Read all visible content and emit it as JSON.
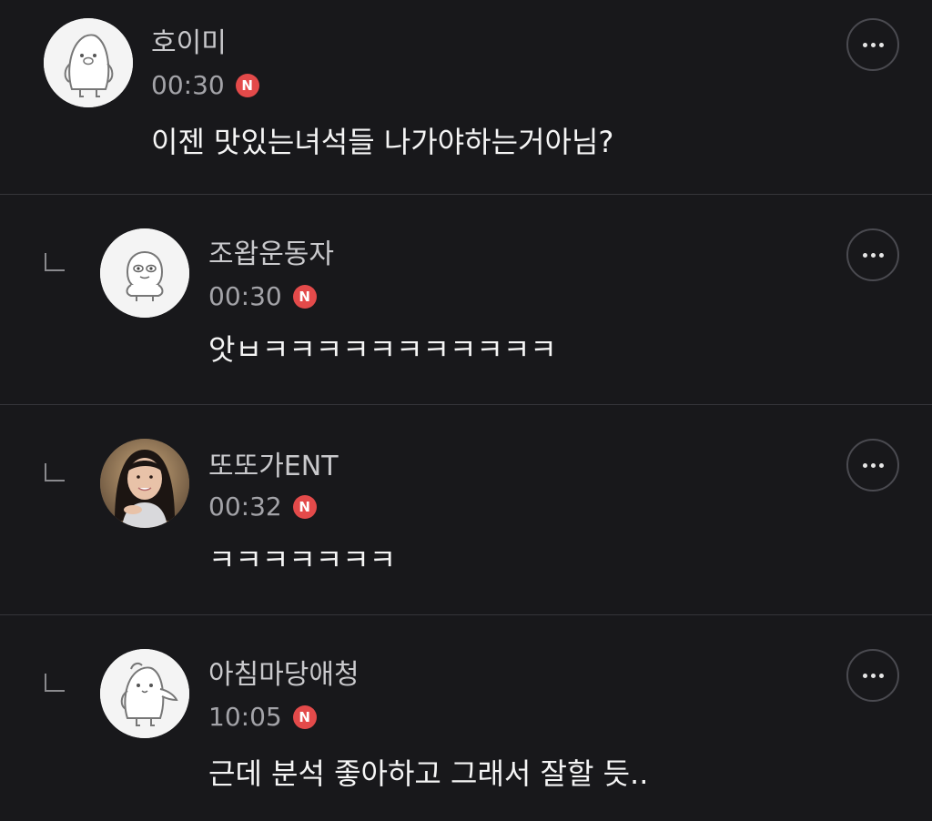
{
  "comments": [
    {
      "nickname": "호이미",
      "time": "00:30",
      "badge": "N",
      "text": "이젠 맛있는녀석들 나가야하는거아님?",
      "avatar": "default-penguin-avatar",
      "is_reply": false
    },
    {
      "nickname": "조왑운동자",
      "time": "00:30",
      "badge": "N",
      "text": "앗ㅂㅋㅋㅋㅋㅋㅋㅋㅋㅋㅋㅋ",
      "avatar": "default-character-avatar",
      "is_reply": true
    },
    {
      "nickname": "또또가ENT",
      "time": "00:32",
      "badge": "N",
      "text": "ㅋㅋㅋㅋㅋㅋㅋ",
      "avatar": "photo-avatar",
      "is_reply": true
    },
    {
      "nickname": "아침마당애청",
      "time": "10:05",
      "badge": "N",
      "text": "근데 분석 좋아하고 그래서 잘할 듯..",
      "avatar": "default-penguin-avatar",
      "is_reply": true
    }
  ],
  "colors": {
    "background": "#18181b",
    "badge": "#e34a4a",
    "divider": "#35353a"
  },
  "icons": {
    "more": "more-options-icon",
    "reply": "reply-indent-icon",
    "badge": "new-badge-icon"
  }
}
